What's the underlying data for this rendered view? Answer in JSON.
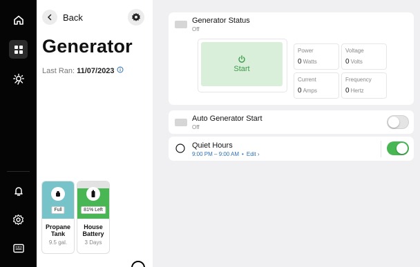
{
  "nav": {
    "back_label": "Back"
  },
  "page": {
    "title": "Generator",
    "last_ran_label": "Last Ran:",
    "last_ran_value": "11/07/2023"
  },
  "tiles": [
    {
      "badge": "Full",
      "name": "Propane Tank",
      "sub": "9.5 gal.",
      "color": "#76c3c9"
    },
    {
      "badge": "81% Left",
      "name": "House Battery",
      "sub": "3 Days",
      "color": "#47b653",
      "level": 0.81
    }
  ],
  "generator": {
    "title": "Generator Status",
    "status": "Off",
    "start_label": "Start",
    "metrics": {
      "power": {
        "label": "Power",
        "value": "0",
        "unit": "Watts"
      },
      "voltage": {
        "label": "Voltage",
        "value": "0",
        "unit": "Volts"
      },
      "current": {
        "label": "Current",
        "value": "0",
        "unit": "Amps"
      },
      "frequency": {
        "label": "Frequency",
        "value": "0",
        "unit": "Hertz"
      }
    }
  },
  "auto_start": {
    "title": "Auto Generator Start",
    "status": "Off",
    "enabled": false
  },
  "quiet_hours": {
    "title": "Quiet Hours",
    "schedule": "9:00 PM – 9:00 AM",
    "edit_label": "Edit",
    "enabled": true
  },
  "colors": {
    "accent_green": "#47b653",
    "start_bg": "#d9efd9",
    "link_blue": "#2f6fb0",
    "rail_bg": "#050505",
    "content_bg": "#f0f0f2"
  },
  "icons": {
    "rail": [
      "home-icon",
      "dashboard-icon",
      "weather-icon",
      "bell-icon",
      "settings-icon",
      "keyboard-icon"
    ],
    "header": [
      "chevron-left-icon",
      "gear-icon",
      "info-icon"
    ],
    "generator": [
      "generator-icon",
      "power-icon",
      "moon-icon"
    ]
  }
}
